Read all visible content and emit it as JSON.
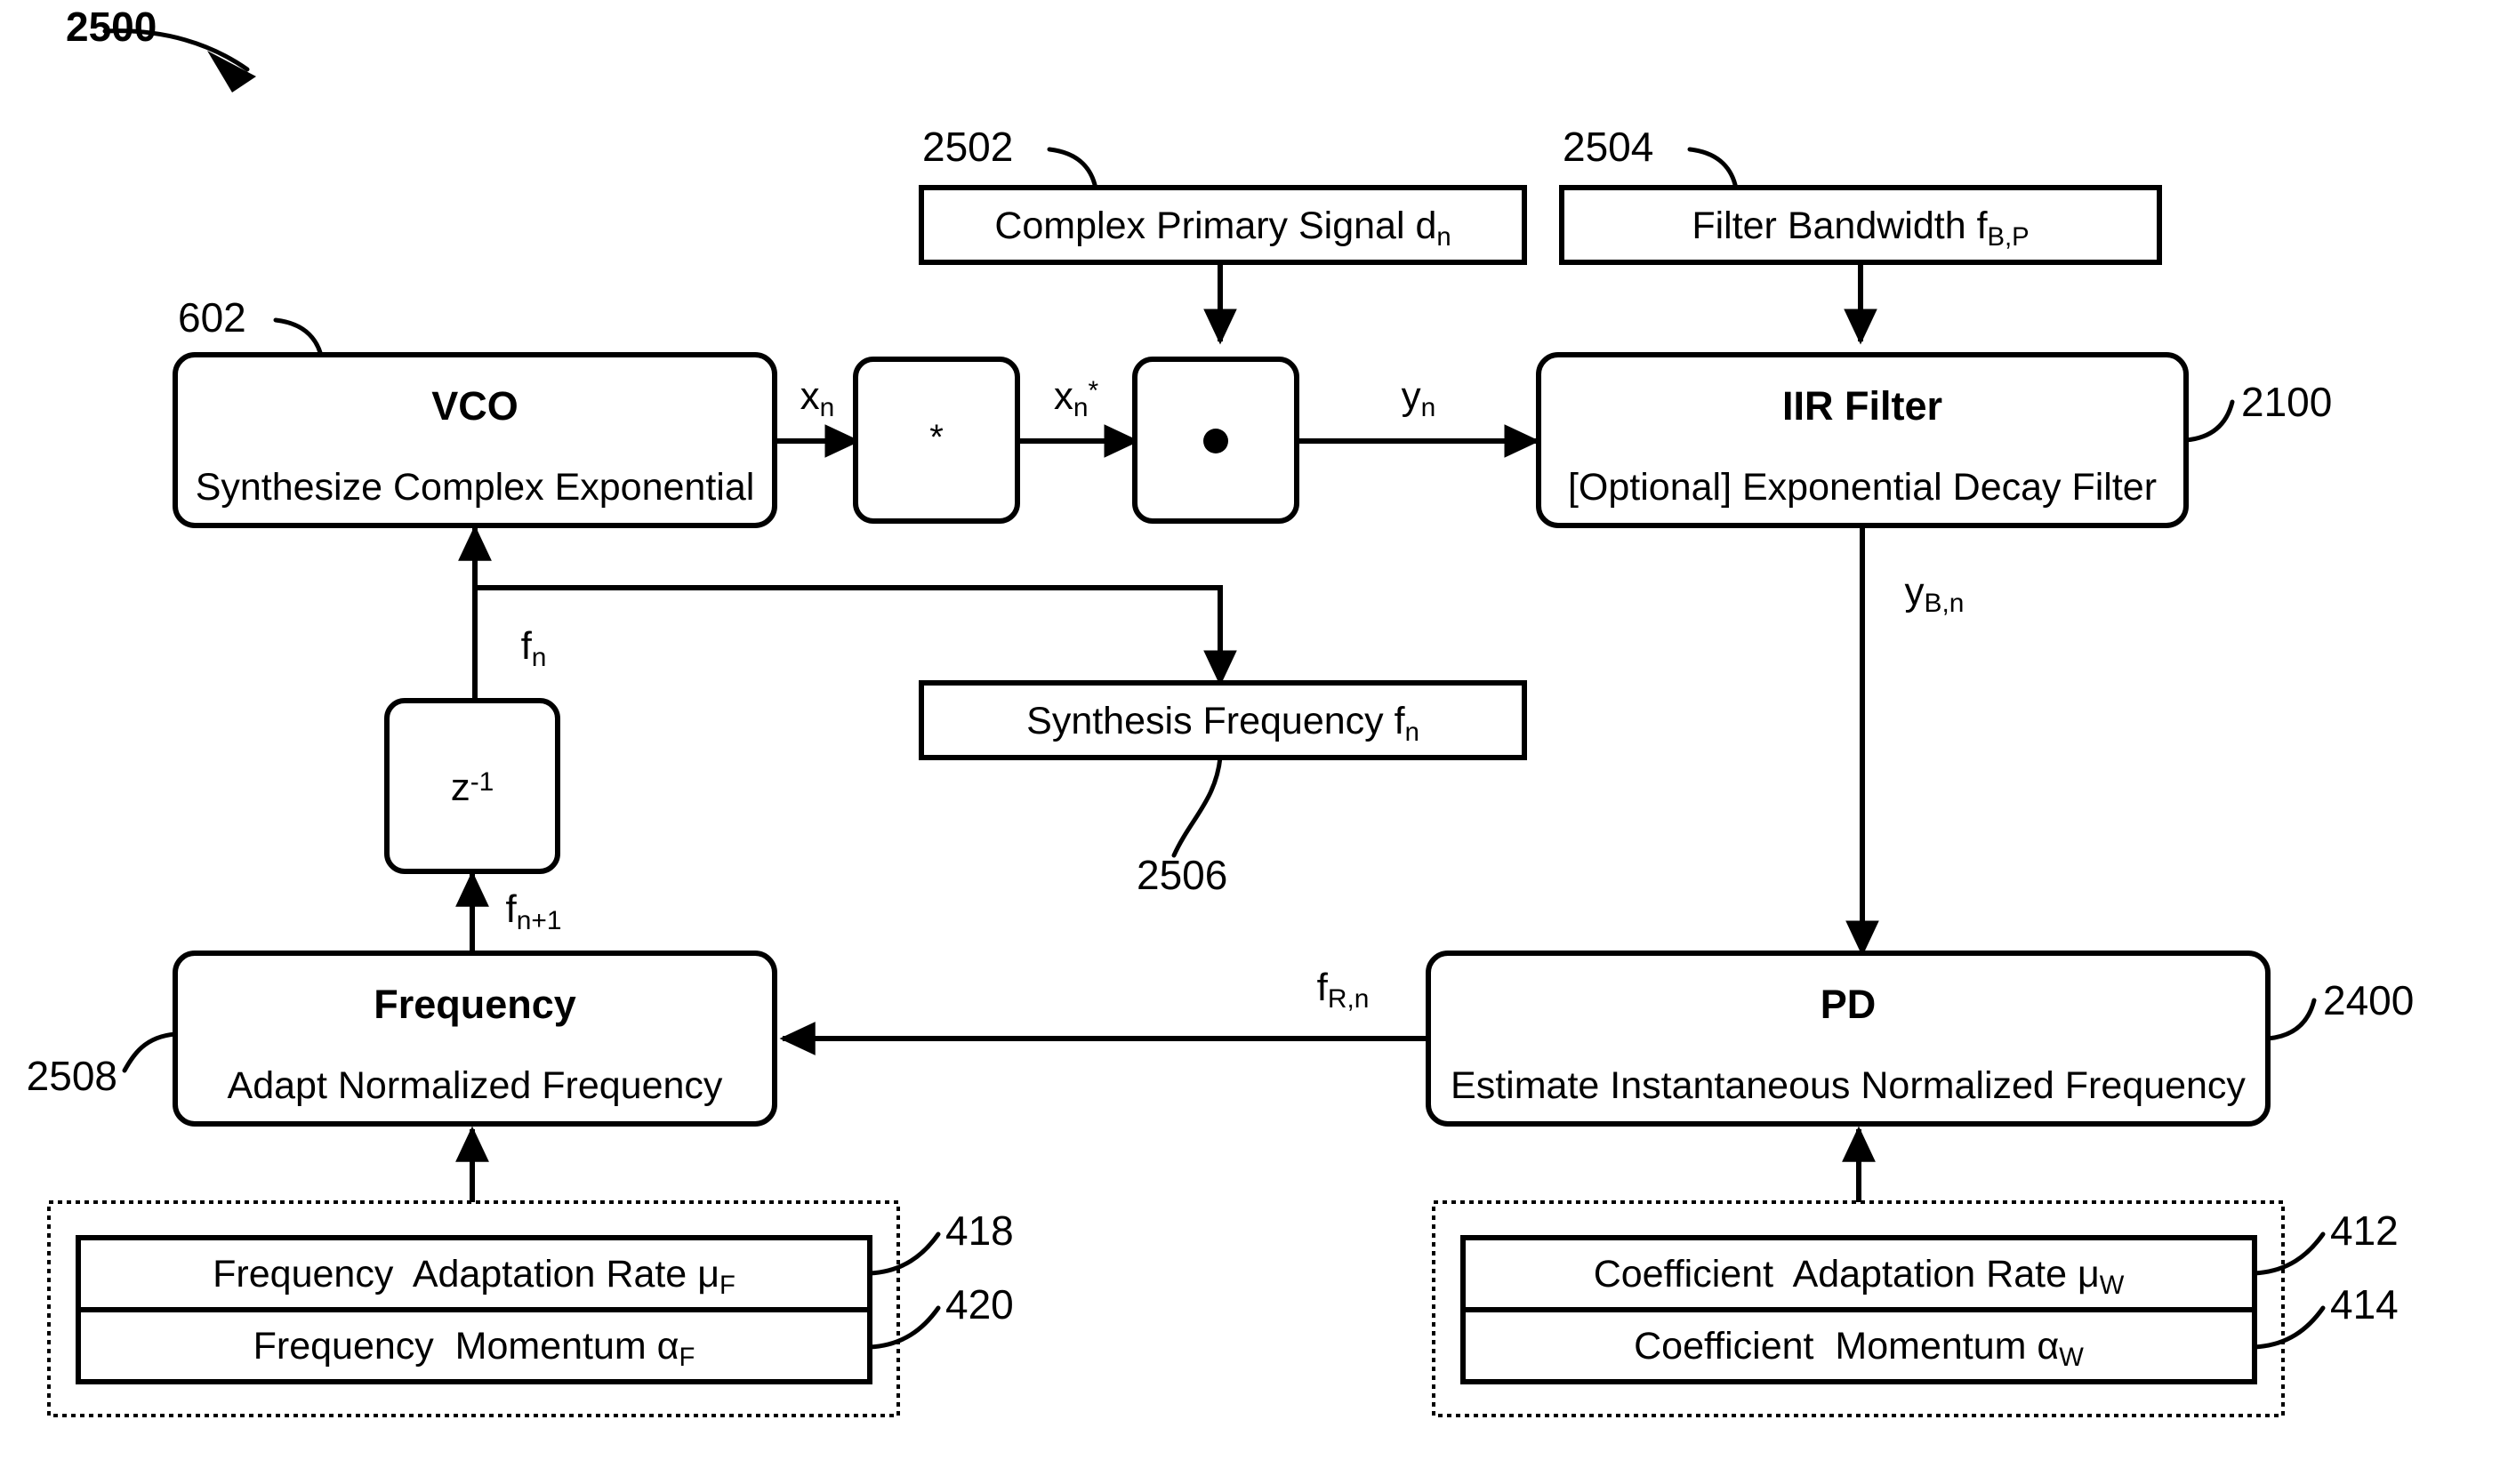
{
  "figure": {
    "number": "2500",
    "type": "patent-block-diagram"
  },
  "refs": {
    "vco": "602",
    "iir_filter": "2100",
    "primary_signal": "2502",
    "filter_bandwidth": "2504",
    "synthesis_frequency": "2506",
    "frequency_adapt": "2508",
    "pd": "2400",
    "freq_adaptation_rate": "418",
    "freq_momentum": "420",
    "coef_adaptation_rate": "412",
    "coef_momentum": "414"
  },
  "blocks": {
    "primary_signal": {
      "label_main": "Complex Primary Signal d",
      "label_sub": "n"
    },
    "filter_bandwidth": {
      "label_main": "Filter Bandwidth f",
      "label_sub": "B,P"
    },
    "vco": {
      "title": "VCO",
      "subtitle": "Synthesize Complex Exponential"
    },
    "conjugate": {
      "symbol": "*",
      "name": "complex-conjugate"
    },
    "multiplier": {
      "symbol": "•",
      "name": "complex-multiply"
    },
    "iir_filter": {
      "title": "IIR Filter",
      "subtitle": "[Optional] Exponential Decay Filter"
    },
    "delay": {
      "symbol_main": "z",
      "symbol_sup": "-1"
    },
    "synthesis_frequency": {
      "label_main": "Synthesis Frequency f",
      "label_sub": "n"
    },
    "frequency": {
      "title": "Frequency",
      "subtitle": "Adapt Normalized Frequency"
    },
    "pd": {
      "title": "PD",
      "subtitle": "Estimate Instantaneous Normalized Frequency"
    }
  },
  "parameter_groups": {
    "frequency_params": {
      "rows": [
        {
          "label_main": "Frequency  Adaptation Rate ",
          "label_var": "μ",
          "label_sub": "F"
        },
        {
          "label_main": "Frequency  Momentum ",
          "label_var": "α",
          "label_sub": "F"
        }
      ]
    },
    "coefficient_params": {
      "rows": [
        {
          "label_main": "Coefficient  Adaptation Rate ",
          "label_var": "μ",
          "label_sub": "W"
        },
        {
          "label_main": "Coefficient  Momentum ",
          "label_var": "α",
          "label_sub": "W"
        }
      ]
    }
  },
  "signals": {
    "xn": {
      "main": "x",
      "sub": "n"
    },
    "xn_conj": {
      "main": "x",
      "sub": "n",
      "sup": "*"
    },
    "yn": {
      "main": "y",
      "sub": "n"
    },
    "ybn": {
      "main": "y",
      "sub": "B,n"
    },
    "fn": {
      "main": "f",
      "sub": "n"
    },
    "fn1": {
      "main": "f",
      "sub": "n+1"
    },
    "frn": {
      "main": "f",
      "sub": "R,n"
    }
  },
  "colors": {
    "stroke": "#000000",
    "fill": "#ffffff",
    "background": "#ffffff"
  }
}
